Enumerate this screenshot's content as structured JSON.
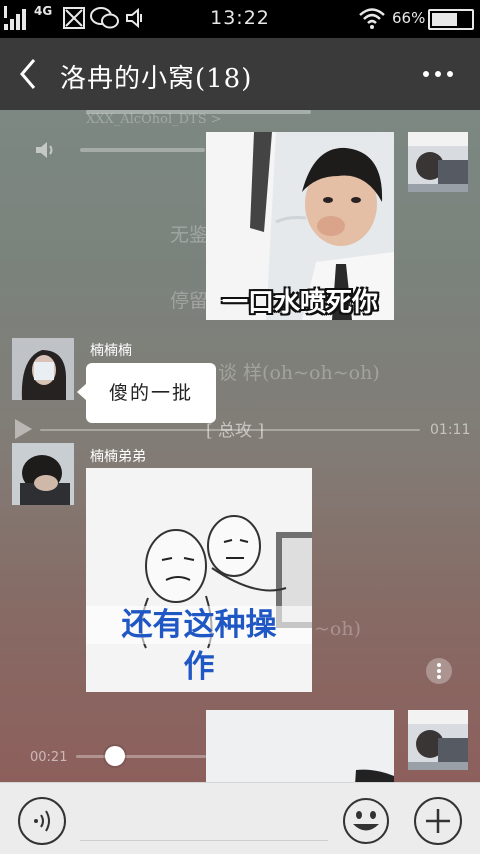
{
  "status_bar": {
    "time": "13:22",
    "network": "4G",
    "battery": "66%",
    "battery_level": 0.66
  },
  "header": {
    "title": "洛冉的小窝(18)"
  },
  "background_music": {
    "lyric_top": "XXX_AlcOhol_DTS >",
    "lyric_left_1": "无鉴",
    "lyric_left_2": "停留",
    "lyric_line": "谈 样(oh~oh~oh)",
    "lyric_center": "[ 总攻 ]",
    "duration": "01:11",
    "lyric_bottom": "~oh)",
    "current_time": "00:21",
    "progress": 0.3
  },
  "messages": [
    {
      "type": "image",
      "side": "right",
      "caption": "一口水喷死你"
    },
    {
      "type": "text",
      "side": "left",
      "sender": "楠楠楠",
      "text": "傻的一批"
    },
    {
      "type": "image",
      "side": "left",
      "sender": "楠楠弟弟",
      "caption_line1": "还有这种操",
      "caption_line2": "作"
    },
    {
      "type": "image",
      "side": "right",
      "caption": ""
    }
  ],
  "colors": {
    "title_bar": "#3a3a3a",
    "status_bar": "#000000",
    "input_bar": "#ececec",
    "caption_blue": "#1f57c4"
  }
}
